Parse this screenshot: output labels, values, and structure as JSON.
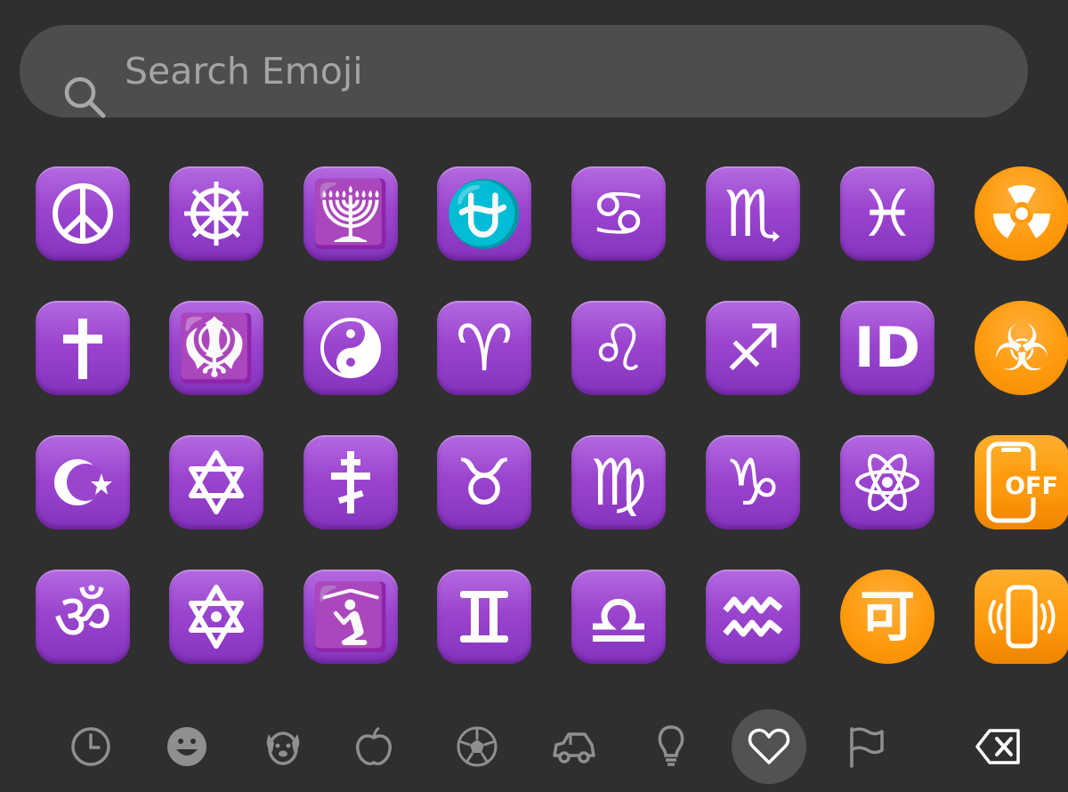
{
  "search": {
    "placeholder": "Search Emoji",
    "value": ""
  },
  "grid": [
    [
      {
        "name": "peace-symbol-icon",
        "style": "purple",
        "glyph": "☮"
      },
      {
        "name": "wheel-of-dharma-icon",
        "style": "purple",
        "glyph": "☸"
      },
      {
        "name": "menorah-icon",
        "style": "purple",
        "glyph": "🕎"
      },
      {
        "name": "ophiuchus-icon",
        "style": "purple",
        "glyph": "⛎"
      },
      {
        "name": "cancer-icon",
        "style": "purple",
        "glyph": "♋"
      },
      {
        "name": "scorpio-icon",
        "style": "purple",
        "glyph": "♏"
      },
      {
        "name": "pisces-icon",
        "style": "purple",
        "glyph": "♓"
      },
      {
        "name": "radioactive-icon",
        "style": "orange-round",
        "glyph": "☢"
      }
    ],
    [
      {
        "name": "latin-cross-icon",
        "style": "purple",
        "glyph": "✝"
      },
      {
        "name": "khanda-icon",
        "style": "purple",
        "glyph": "🪯"
      },
      {
        "name": "yin-yang-icon",
        "style": "purple",
        "glyph": "☯"
      },
      {
        "name": "aries-icon",
        "style": "purple",
        "glyph": "♈"
      },
      {
        "name": "leo-icon",
        "style": "purple",
        "glyph": "♌"
      },
      {
        "name": "sagittarius-icon",
        "style": "purple",
        "glyph": "♐"
      },
      {
        "name": "id-button-icon",
        "style": "purple",
        "glyph": "ID"
      },
      {
        "name": "biohazard-icon",
        "style": "orange-round",
        "glyph": "☣"
      }
    ],
    [
      {
        "name": "star-and-crescent-icon",
        "style": "purple",
        "glyph": "☪"
      },
      {
        "name": "star-of-david-icon",
        "style": "purple",
        "glyph": "✡"
      },
      {
        "name": "orthodox-cross-icon",
        "style": "purple",
        "glyph": "☦"
      },
      {
        "name": "taurus-icon",
        "style": "purple",
        "glyph": "♉"
      },
      {
        "name": "virgo-icon",
        "style": "purple",
        "glyph": "♍"
      },
      {
        "name": "capricorn-icon",
        "style": "purple",
        "glyph": "♑"
      },
      {
        "name": "atom-symbol-icon",
        "style": "purple",
        "glyph": "⚛"
      },
      {
        "name": "mobile-phone-off-icon",
        "style": "orange-sq",
        "glyph": "OFF"
      }
    ],
    [
      {
        "name": "om-icon",
        "style": "purple",
        "glyph": "ॐ"
      },
      {
        "name": "dotted-six-pointed-star-icon",
        "style": "purple",
        "glyph": "🔯"
      },
      {
        "name": "place-of-worship-icon",
        "style": "purple",
        "glyph": "🛐"
      },
      {
        "name": "gemini-icon",
        "style": "purple",
        "glyph": "♊"
      },
      {
        "name": "libra-icon",
        "style": "purple",
        "glyph": "♎"
      },
      {
        "name": "aquarius-icon",
        "style": "purple",
        "glyph": "♒"
      },
      {
        "name": "japanese-acceptable-button-icon",
        "style": "orange-round",
        "glyph": "可"
      },
      {
        "name": "vibration-mode-icon",
        "style": "orange-sq",
        "glyph": "📳"
      }
    ]
  ],
  "categories": [
    {
      "name": "recent-icon",
      "active": false
    },
    {
      "name": "smileys-icon",
      "active": false
    },
    {
      "name": "animals-icon",
      "active": false
    },
    {
      "name": "food-icon",
      "active": false
    },
    {
      "name": "activity-icon",
      "active": false
    },
    {
      "name": "travel-icon",
      "active": false
    },
    {
      "name": "objects-icon",
      "active": false
    },
    {
      "name": "symbols-icon",
      "active": true
    },
    {
      "name": "flags-icon",
      "active": false
    },
    {
      "name": "delete-backspace-icon",
      "active": false
    }
  ],
  "colors": {
    "background": "#2f2f2f",
    "search_bg": "#4d4d4d",
    "purple": "#9b45cf",
    "orange": "#ff9a0c",
    "tab_icon": "#8f8f8f",
    "active_tab_bg": "#525252"
  }
}
